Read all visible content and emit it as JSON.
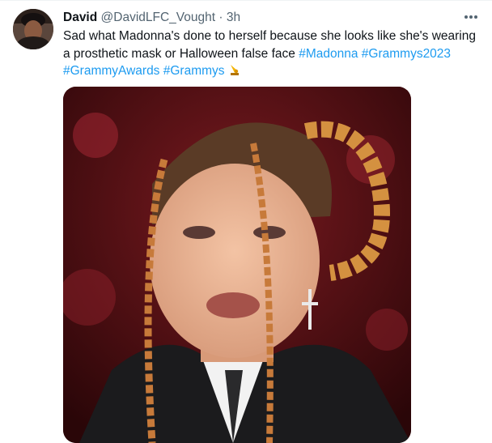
{
  "tweet": {
    "author_name": "David",
    "handle": "@DavidLFC_Vought",
    "separator": "·",
    "time": "3h",
    "text_prefix": "Sad what Madonna's done to herself because she looks like she's wearing a prosthetic mask or Halloween false face",
    "hashtags": [
      "#Madonna",
      "#Grammys2023",
      "#GrammyAwards",
      "#Grammys"
    ],
    "emoji": "gramophone-emoji",
    "more_icon": "more-horizontal-icon"
  },
  "colors": {
    "link": "#1d9bf0",
    "secondary_text": "#536471",
    "primary_text": "#0f1419"
  }
}
